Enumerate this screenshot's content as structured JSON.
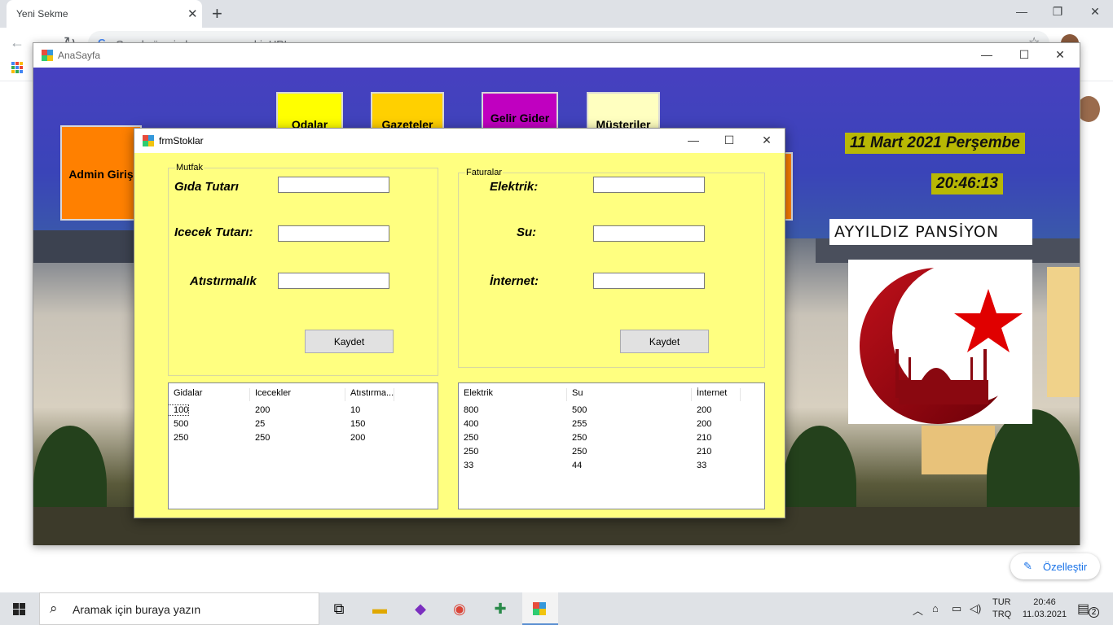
{
  "chrome": {
    "tab_title": "Yeni Sekme",
    "close_glyph": "✕",
    "new_tab_glyph": "+",
    "omnibox_placeholder": "Google üzerinde arayın veya bir URL yazın",
    "customize_label": "Özelleştir"
  },
  "anasayfa": {
    "title": "AnaSayfa",
    "admin_button": "Admin  Giriş",
    "menu": {
      "odalar": "Odalar",
      "gazeteler": "Gazeteler",
      "gelir_gider": "Gelir Gider",
      "musteriler": "Müsteriler"
    },
    "date": "11 Mart 2021 Perşembe",
    "time": "20:46:13",
    "pension_name": "AYYILDIZ PANSİYON",
    "colors": {
      "admin": "#ff8000",
      "odalar": "#ffff00",
      "gazeteler": "#ffd000",
      "gelir_gider": "#c000c0",
      "musteriler": "#ffffc0",
      "flag_red": "#e00000"
    }
  },
  "frm": {
    "title": "frmStoklar",
    "mutfak": {
      "legend": "Mutfak",
      "gida_label": "Gıda Tutarı",
      "icecek_label": "Icecek Tutarı:",
      "atistirmalik_label": "Atıstırmalık",
      "gida_value": "",
      "icecek_value": "",
      "atistirmalik_value": "",
      "save_label": "Kaydet"
    },
    "faturalar": {
      "legend": "Faturalar",
      "elektrik_label": "Elektrik:",
      "su_label": "Su:",
      "internet_label": "İnternet:",
      "elektrik_value": "",
      "su_value": "",
      "internet_value": "",
      "save_label": "Kaydet"
    },
    "mutfak_list": {
      "columns": [
        "Gidalar",
        "Icecekler",
        "Atıstırma..."
      ],
      "rows": [
        [
          "100",
          "200",
          "10"
        ],
        [
          "500",
          "25",
          "150"
        ],
        [
          "250",
          "250",
          "200"
        ]
      ]
    },
    "fatura_list": {
      "columns": [
        "Elektrik",
        "Su",
        "İnternet"
      ],
      "rows": [
        [
          "800",
          "500",
          "200"
        ],
        [
          "400",
          "255",
          "200"
        ],
        [
          "250",
          "250",
          "210"
        ],
        [
          "250",
          "250",
          "210"
        ],
        [
          "33",
          "44",
          "33"
        ]
      ]
    }
  },
  "taskbar": {
    "search_placeholder": "Aramak için buraya yazın",
    "lang_line1": "TUR",
    "lang_line2": "TRQ",
    "time": "20:46",
    "date": "11.03.2021",
    "notification_count": "2"
  }
}
